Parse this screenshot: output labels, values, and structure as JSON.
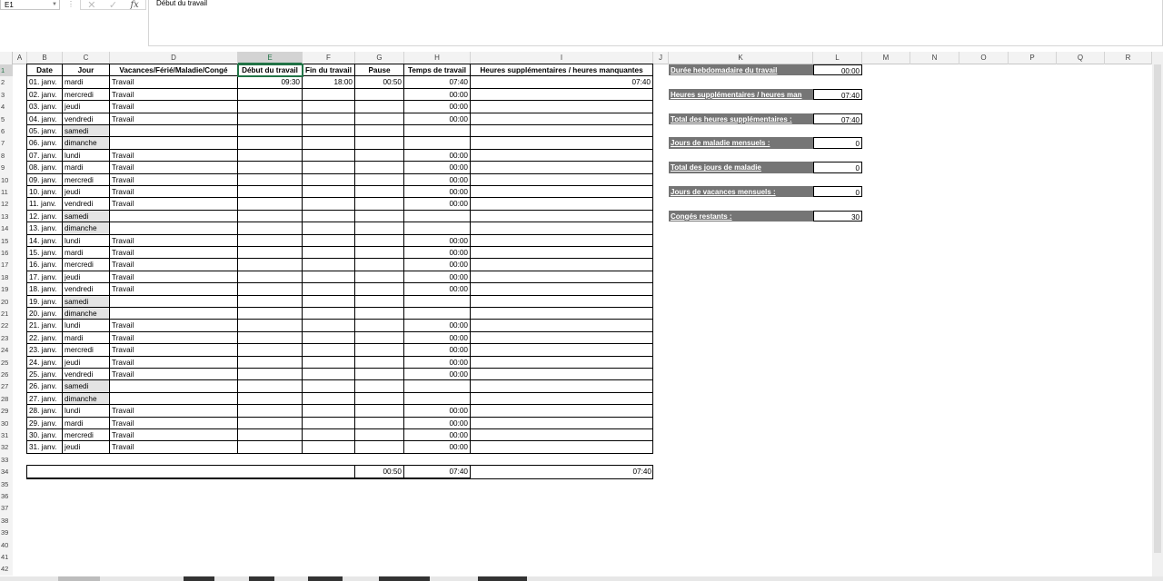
{
  "formula_bar": {
    "name_box": "E1",
    "content": "Début du travail",
    "cancel_glyph": "✕",
    "enter_glyph": "✓",
    "fx_label": "fx"
  },
  "columns": [
    "A",
    "B",
    "C",
    "D",
    "E",
    "F",
    "G",
    "H",
    "I",
    "J",
    "K",
    "L",
    "M",
    "N",
    "O",
    "P",
    "Q",
    "R"
  ],
  "selected_column": "E",
  "headers": {
    "date": "Date",
    "jour": "Jour",
    "type": "Vacances/Férié/Maladie/Congé",
    "debut": "Début du travail",
    "fin": "Fin du travail",
    "pause": "Pause",
    "temps": "Temps de travail",
    "heures": "Heures supplémentaires / heures manquantes"
  },
  "rows": [
    {
      "date": "01. janv.",
      "jour": "mardi",
      "type": "Travail",
      "debut": "09:30",
      "fin": "18:00",
      "pause": "00:50",
      "temps": "07:40",
      "heures": "07:40",
      "weekend": false
    },
    {
      "date": "02. janv.",
      "jour": "mercredi",
      "type": "Travail",
      "debut": "",
      "fin": "",
      "pause": "",
      "temps": "00:00",
      "heures": "",
      "weekend": false
    },
    {
      "date": "03. janv.",
      "jour": "jeudi",
      "type": "Travail",
      "debut": "",
      "fin": "",
      "pause": "",
      "temps": "00:00",
      "heures": "",
      "weekend": false
    },
    {
      "date": "04. janv.",
      "jour": "vendredi",
      "type": "Travail",
      "debut": "",
      "fin": "",
      "pause": "",
      "temps": "00:00",
      "heures": "",
      "weekend": false
    },
    {
      "date": "05. janv.",
      "jour": "samedi",
      "type": "",
      "debut": "",
      "fin": "",
      "pause": "",
      "temps": "",
      "heures": "",
      "weekend": true
    },
    {
      "date": "06. janv.",
      "jour": "dimanche",
      "type": "",
      "debut": "",
      "fin": "",
      "pause": "",
      "temps": "",
      "heures": "",
      "weekend": true
    },
    {
      "date": "07. janv.",
      "jour": "lundi",
      "type": "Travail",
      "debut": "",
      "fin": "",
      "pause": "",
      "temps": "00:00",
      "heures": "",
      "weekend": false
    },
    {
      "date": "08. janv.",
      "jour": "mardi",
      "type": "Travail",
      "debut": "",
      "fin": "",
      "pause": "",
      "temps": "00:00",
      "heures": "",
      "weekend": false
    },
    {
      "date": "09. janv.",
      "jour": "mercredi",
      "type": "Travail",
      "debut": "",
      "fin": "",
      "pause": "",
      "temps": "00:00",
      "heures": "",
      "weekend": false
    },
    {
      "date": "10. janv.",
      "jour": "jeudi",
      "type": "Travail",
      "debut": "",
      "fin": "",
      "pause": "",
      "temps": "00:00",
      "heures": "",
      "weekend": false
    },
    {
      "date": "11. janv.",
      "jour": "vendredi",
      "type": "Travail",
      "debut": "",
      "fin": "",
      "pause": "",
      "temps": "00:00",
      "heures": "",
      "weekend": false
    },
    {
      "date": "12. janv.",
      "jour": "samedi",
      "type": "",
      "debut": "",
      "fin": "",
      "pause": "",
      "temps": "",
      "heures": "",
      "weekend": true
    },
    {
      "date": "13. janv.",
      "jour": "dimanche",
      "type": "",
      "debut": "",
      "fin": "",
      "pause": "",
      "temps": "",
      "heures": "",
      "weekend": true
    },
    {
      "date": "14. janv.",
      "jour": "lundi",
      "type": "Travail",
      "debut": "",
      "fin": "",
      "pause": "",
      "temps": "00:00",
      "heures": "",
      "weekend": false
    },
    {
      "date": "15. janv.",
      "jour": "mardi",
      "type": "Travail",
      "debut": "",
      "fin": "",
      "pause": "",
      "temps": "00:00",
      "heures": "",
      "weekend": false
    },
    {
      "date": "16. janv.",
      "jour": "mercredi",
      "type": "Travail",
      "debut": "",
      "fin": "",
      "pause": "",
      "temps": "00:00",
      "heures": "",
      "weekend": false
    },
    {
      "date": "17. janv.",
      "jour": "jeudi",
      "type": "Travail",
      "debut": "",
      "fin": "",
      "pause": "",
      "temps": "00:00",
      "heures": "",
      "weekend": false
    },
    {
      "date": "18. janv.",
      "jour": "vendredi",
      "type": "Travail",
      "debut": "",
      "fin": "",
      "pause": "",
      "temps": "00:00",
      "heures": "",
      "weekend": false
    },
    {
      "date": "19. janv.",
      "jour": "samedi",
      "type": "",
      "debut": "",
      "fin": "",
      "pause": "",
      "temps": "",
      "heures": "",
      "weekend": true
    },
    {
      "date": "20. janv.",
      "jour": "dimanche",
      "type": "",
      "debut": "",
      "fin": "",
      "pause": "",
      "temps": "",
      "heures": "",
      "weekend": true
    },
    {
      "date": "21. janv.",
      "jour": "lundi",
      "type": "Travail",
      "debut": "",
      "fin": "",
      "pause": "",
      "temps": "00:00",
      "heures": "",
      "weekend": false
    },
    {
      "date": "22. janv.",
      "jour": "mardi",
      "type": "Travail",
      "debut": "",
      "fin": "",
      "pause": "",
      "temps": "00:00",
      "heures": "",
      "weekend": false
    },
    {
      "date": "23. janv.",
      "jour": "mercredi",
      "type": "Travail",
      "debut": "",
      "fin": "",
      "pause": "",
      "temps": "00:00",
      "heures": "",
      "weekend": false
    },
    {
      "date": "24. janv.",
      "jour": "jeudi",
      "type": "Travail",
      "debut": "",
      "fin": "",
      "pause": "",
      "temps": "00:00",
      "heures": "",
      "weekend": false
    },
    {
      "date": "25. janv.",
      "jour": "vendredi",
      "type": "Travail",
      "debut": "",
      "fin": "",
      "pause": "",
      "temps": "00:00",
      "heures": "",
      "weekend": false
    },
    {
      "date": "26. janv.",
      "jour": "samedi",
      "type": "",
      "debut": "",
      "fin": "",
      "pause": "",
      "temps": "",
      "heures": "",
      "weekend": true
    },
    {
      "date": "27. janv.",
      "jour": "dimanche",
      "type": "",
      "debut": "",
      "fin": "",
      "pause": "",
      "temps": "",
      "heures": "",
      "weekend": true
    },
    {
      "date": "28. janv.",
      "jour": "lundi",
      "type": "Travail",
      "debut": "",
      "fin": "",
      "pause": "",
      "temps": "00:00",
      "heures": "",
      "weekend": false
    },
    {
      "date": "29. janv.",
      "jour": "mardi",
      "type": "Travail",
      "debut": "",
      "fin": "",
      "pause": "",
      "temps": "00:00",
      "heures": "",
      "weekend": false
    },
    {
      "date": "30. janv.",
      "jour": "mercredi",
      "type": "Travail",
      "debut": "",
      "fin": "",
      "pause": "",
      "temps": "00:00",
      "heures": "",
      "weekend": false
    },
    {
      "date": "31. janv.",
      "jour": "jeudi",
      "type": "Travail",
      "debut": "",
      "fin": "",
      "pause": "",
      "temps": "00:00",
      "heures": "",
      "weekend": false
    }
  ],
  "totals": {
    "pause": "00:50",
    "temps": "07:40",
    "heures": "07:40"
  },
  "summary": [
    {
      "label": "Durée hebdomadaire du travail",
      "value": "00:00"
    },
    {
      "label": "Heures supplémentaires / heures man",
      "value": "07:40"
    },
    {
      "label": "Total des heures supplémentaires :",
      "value": "07:40"
    },
    {
      "label": "Jours de maladie mensuels :",
      "value": "0"
    },
    {
      "label": "Total des jours de maladie",
      "value": "0"
    },
    {
      "label": "Jours de vacances mensuels :",
      "value": "0"
    },
    {
      "label": "Congés restants :",
      "value": "30"
    }
  ],
  "colors": {
    "selection": "#217346",
    "summary_label_bg": "#757575",
    "weekend_bg": "#e4e4e4"
  }
}
